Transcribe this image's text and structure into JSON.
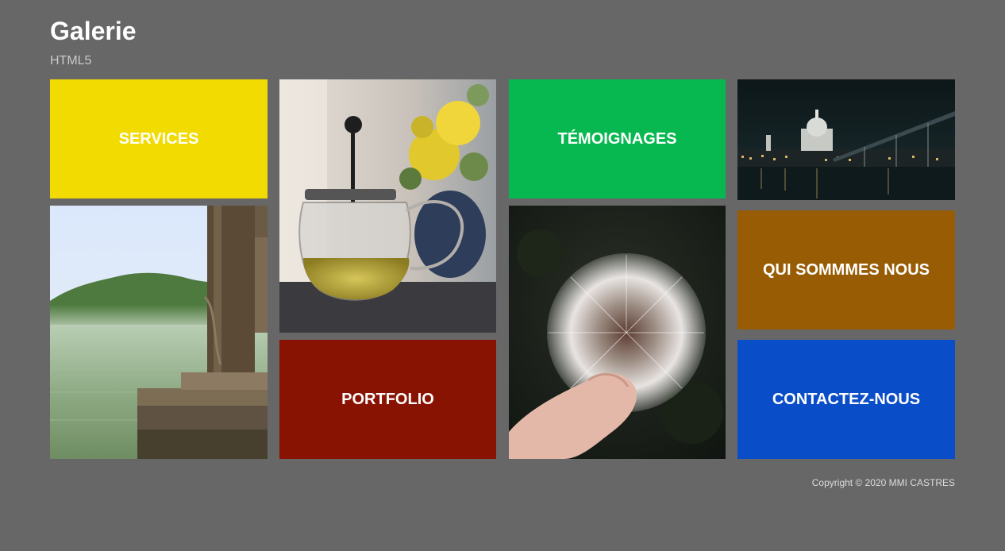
{
  "header": {
    "title": "Galerie",
    "subtitle": "HTML5"
  },
  "tiles": {
    "services": {
      "label": "SERVICES",
      "color": "#f2db00"
    },
    "temoignages": {
      "label": "TÉMOIGNAGES",
      "color": "#06b84f"
    },
    "qui": {
      "label": "QUI SOMMMES NOUS",
      "color": "#985c05"
    },
    "portfolio": {
      "label": "PORTFOLIO",
      "color": "#891302"
    },
    "contact": {
      "label": "CONTACTEZ-NOUS",
      "color": "#0a4dc8"
    }
  },
  "images": {
    "lake": "lake-dock-photo",
    "teapot": "teapot-flowers-photo",
    "city": "city-night-photo",
    "dandelion": "dandelion-photo"
  },
  "footer": {
    "copyright": "Copyright © 2020 MMI CASTRES"
  }
}
